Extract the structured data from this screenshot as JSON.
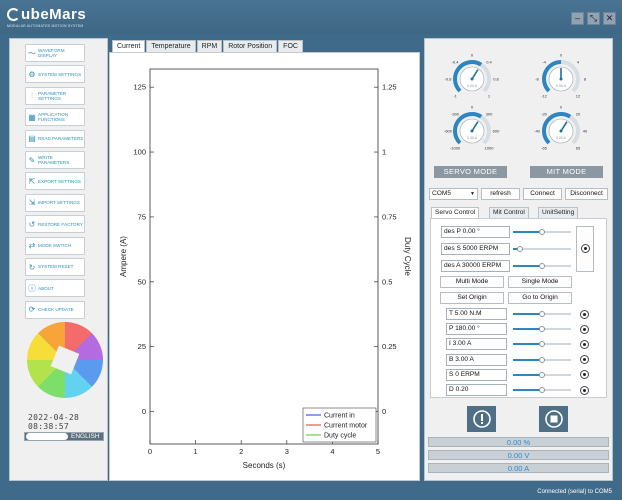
{
  "app": {
    "logo": "CubeMars",
    "logo_tagline": "MODULAR AUTOMATED MOTION SYSTEM",
    "window_buttons": [
      "–",
      "⤡",
      "✕"
    ]
  },
  "sidebar": {
    "items": [
      {
        "label": "WAVEFORM DISPLAY",
        "icon": "waveform-icon",
        "glyph": "〜"
      },
      {
        "label": "SYSTEM SETTINGS",
        "icon": "gear-icon",
        "glyph": "⚙"
      },
      {
        "label": "PARAMETER SETTINGS",
        "icon": "sliders-icon",
        "glyph": "⫶"
      },
      {
        "label": "APPLICATION FUNCTIONS",
        "icon": "grid-icon",
        "glyph": "▦"
      },
      {
        "label": "READ PARAMETERS",
        "icon": "read-icon",
        "glyph": "▤"
      },
      {
        "label": "WRITE PARAMETERS",
        "icon": "write-icon",
        "glyph": "✎"
      },
      {
        "label": "EXPORT SETTINGS",
        "icon": "export-icon",
        "glyph": "⇱"
      },
      {
        "label": "IMPORT SETTINGS",
        "icon": "import-icon",
        "glyph": "⇲"
      },
      {
        "label": "RESTORE FACTORY",
        "icon": "restore-icon",
        "glyph": "↺"
      },
      {
        "label": "MODE SWITCH",
        "icon": "switch-icon",
        "glyph": "⇄"
      },
      {
        "label": "SYSTEM RESET",
        "icon": "reset-icon",
        "glyph": "↻"
      },
      {
        "label": "ABOUT",
        "icon": "info-icon",
        "glyph": "ⓘ"
      },
      {
        "label": "CHECK UPDATE",
        "icon": "update-icon",
        "glyph": "⟳"
      }
    ],
    "datetime": "2022-04-28 08:38:57",
    "language": "ENGLISH"
  },
  "tabs": [
    "Current",
    "Temperature",
    "RPM",
    "Rotor Position",
    "FOC"
  ],
  "chart_data": {
    "type": "line",
    "xlabel": "Seconds (s)",
    "ylabel": "Ampere (A)",
    "y2label": "Duty Cycle",
    "xlim": [
      0,
      5
    ],
    "ylim": [
      -12.5,
      132
    ],
    "y2lim": [
      -0.125,
      1.32
    ],
    "x_ticks": [
      "0",
      "1",
      "2",
      "3",
      "4",
      "5"
    ],
    "y_ticks": [
      "0",
      "25",
      "50",
      "75",
      "100",
      "125"
    ],
    "y2_ticks": [
      "0",
      "0.25",
      "0.5",
      "0.75",
      "1",
      "1.25"
    ],
    "grid": false,
    "legend_position": "bottom-right",
    "series": [
      {
        "name": "Current in",
        "color": "#5b74f0",
        "values": []
      },
      {
        "name": "Current motor",
        "color": "#f06a6a",
        "values": []
      },
      {
        "name": "Duty cycle",
        "color": "#7fd66a",
        "values": []
      }
    ]
  },
  "right": {
    "gauges": [
      {
        "ticks": [
          "-1",
          "-0.8",
          "-0.4",
          "0",
          "0.4",
          "0.8",
          "1"
        ],
        "value_text": "0.00 A",
        "level": 0.62
      },
      {
        "ticks": [
          "-12",
          "-8",
          "-4",
          "0",
          "4",
          "8",
          "12"
        ],
        "value_text": "0.00 A",
        "level": 0.5
      },
      {
        "ticks": [
          "-1000",
          "-600",
          "-300",
          "0",
          "300",
          "600",
          "1000"
        ],
        "value_text": "0.00 A",
        "level": 0.62
      },
      {
        "ticks": [
          "-65",
          "-40",
          "-20",
          "0",
          "20",
          "40",
          "65"
        ],
        "value_text": "0.00 A",
        "level": 0.62
      }
    ],
    "servo_mode": "SERVO MODE",
    "mit_mode": "MIT MODE",
    "com_port": "COM5",
    "refresh": "refresh",
    "connect": "Connect",
    "disconnect": "Disconnect",
    "subtabs": [
      "Servo Control",
      "Mit Control",
      "UnitSetting"
    ],
    "servo": {
      "des_p": "des P 0.00 °",
      "des_s": "des S 5000 ERPM",
      "des_a": "des A 30000 ERPM",
      "des_p_level": 0.5,
      "des_s_level": 0.12,
      "des_a_level": 0.5,
      "multi_mode": "Multi Mode",
      "single_mode": "Single Mode",
      "set_origin": "Set Origin",
      "go_to_origin": "Go to Origin",
      "params": [
        {
          "label": "T 5.00 N.M",
          "level": 0.5
        },
        {
          "label": "P 180.00 °",
          "level": 0.5
        },
        {
          "label": "I 3.00 A",
          "level": 0.5
        },
        {
          "label": "B 3.00 A",
          "level": 0.5
        },
        {
          "label": "S 0 ERPM",
          "level": 0.5
        },
        {
          "label": "D 0.20",
          "level": 0.5
        }
      ]
    },
    "readouts": [
      "0.00 %",
      "0.00 V",
      "0.00 A"
    ]
  },
  "status_bar": "Connected (serial) to COM5",
  "colors": {
    "accent": "#2e86c1",
    "header": "#3f6a8a",
    "readout": "#2a8bd0"
  }
}
